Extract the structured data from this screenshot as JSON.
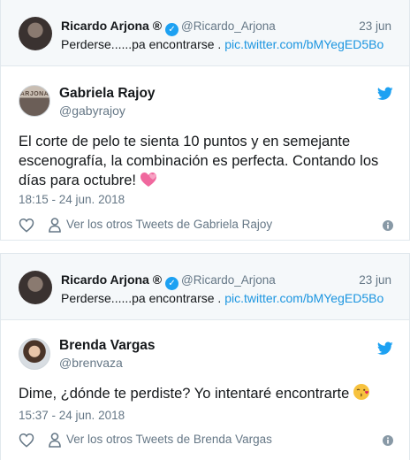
{
  "cards": [
    {
      "quote": {
        "name": "Ricardo Arjona ®",
        "handle": "@Ricardo_Arjona",
        "date": "23 jun",
        "text": "Perderse......pa encontrarse .",
        "link": "pic.twitter.com/bMYegED5Bo"
      },
      "author": {
        "name": "Gabriela Rajoy",
        "handle": "@gabyrajoy",
        "avatar_text": "ARJONA"
      },
      "body": "El corte de pelo te sienta 10 puntos y en semejante escenografía, la combinación es perfecta. Contando los días para octubre!",
      "emoji": "two-hearts-icon",
      "timestamp": "18:15 - 24 jun. 2018",
      "more_link": "Ver los otros Tweets de Gabriela Rajoy"
    },
    {
      "quote": {
        "name": "Ricardo Arjona ®",
        "handle": "@Ricardo_Arjona",
        "date": "23 jun",
        "text": "Perderse......pa encontrarse .",
        "link": "pic.twitter.com/bMYegED5Bo"
      },
      "author": {
        "name": "Brenda Vargas",
        "handle": "@brenvaza"
      },
      "body": "Dime, ¿dónde te perdiste? Yo intentaré encontrarte",
      "emoji": "kissing-face-icon",
      "timestamp": "15:37 - 24 jun. 2018",
      "more_link": "Ver los otros Tweets de Brenda Vargas"
    }
  ],
  "colors": {
    "twitter_blue": "#1da1f2",
    "link_blue": "#1b95e0",
    "muted_gray": "#657786",
    "quote_bg": "#f5f8fa"
  }
}
